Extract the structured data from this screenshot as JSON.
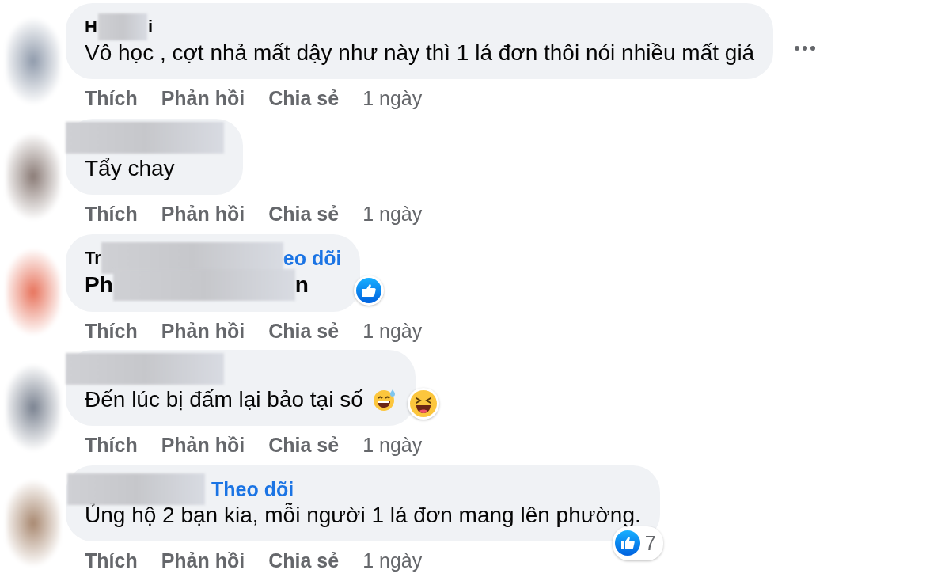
{
  "comments": [
    {
      "more_menu": true,
      "name": [
        {
          "kind": "text",
          "text": "H"
        },
        {
          "kind": "redacted"
        },
        {
          "kind": "text",
          "text": "i"
        }
      ],
      "body": [
        {
          "kind": "text",
          "text": "Vô học , cợt nhả mất dậy như này thì 1 lá đơn thôi nói nhiều mất giá"
        }
      ],
      "actions": [
        "Thích",
        "Phản hồi",
        "Chia sẻ"
      ],
      "time": "1 ngày"
    },
    {
      "name": [
        {
          "kind": "redacted"
        }
      ],
      "body": [
        {
          "kind": "text",
          "text": "Tẩy chay"
        }
      ],
      "actions": [
        "Thích",
        "Phản hồi",
        "Chia sẻ"
      ],
      "time": "1 ngày"
    },
    {
      "name": [
        {
          "kind": "text",
          "text": "Tr"
        },
        {
          "kind": "redacted"
        },
        {
          "kind": "link",
          "text": "eo dõi"
        }
      ],
      "body": [
        {
          "kind": "bold",
          "text": "Ph"
        },
        {
          "kind": "redacted"
        },
        {
          "kind": "bold",
          "text": "n"
        }
      ],
      "reaction": {
        "kind": "like"
      },
      "actions": [
        "Thích",
        "Phản hồi",
        "Chia sẻ"
      ],
      "time": "1 ngày"
    },
    {
      "name": [
        {
          "kind": "redacted"
        }
      ],
      "body": [
        {
          "kind": "text",
          "text": "Đến lúc bị đấm lại bảo tại số"
        },
        {
          "kind": "emoji"
        }
      ],
      "reaction": {
        "kind": "haha"
      },
      "actions": [
        "Thích",
        "Phản hồi",
        "Chia sẻ"
      ],
      "time": "1 ngày"
    },
    {
      "name": [
        {
          "kind": "redacted"
        },
        {
          "kind": "link",
          "text": "Theo dõi"
        }
      ],
      "body": [
        {
          "kind": "text",
          "text": "Ủng hộ 2 bạn kia, mỗi người 1 lá đơn mang lên phường."
        }
      ],
      "reaction": {
        "kind": "like",
        "count": "7"
      },
      "actions": [
        "Thích",
        "Phản hồi",
        "Chia sẻ"
      ],
      "time": "1 ngày"
    }
  ]
}
